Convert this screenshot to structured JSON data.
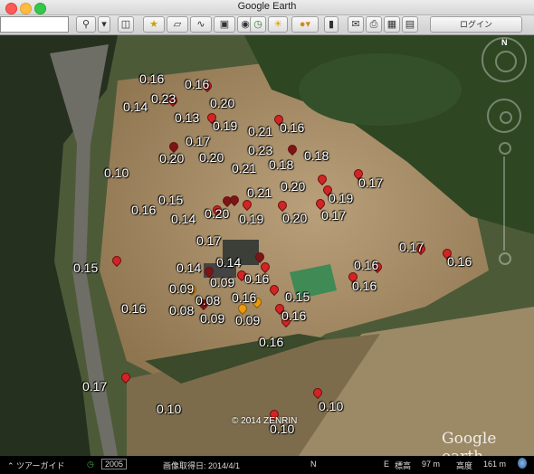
{
  "window": {
    "title": "Google Earth"
  },
  "toolbar": {
    "login_label": "ログイン"
  },
  "map": {
    "watermark": "Google earth",
    "copyright": "© 2014 ZENRIN",
    "compass_north": "N",
    "labels": [
      {
        "t": "0.16"
      },
      {
        "t": "0.16"
      },
      {
        "t": "0.23"
      },
      {
        "t": "0.14"
      },
      {
        "t": "0.20"
      },
      {
        "t": "0.13"
      },
      {
        "t": "0.19"
      },
      {
        "t": "0.21"
      },
      {
        "t": "0.16"
      },
      {
        "t": "0.17"
      },
      {
        "t": "0.23"
      },
      {
        "t": "0.20"
      },
      {
        "t": "0.20"
      },
      {
        "t": "0.18"
      },
      {
        "t": "0.18"
      },
      {
        "t": "0.21"
      },
      {
        "t": "0.10"
      },
      {
        "t": "0.17"
      },
      {
        "t": "0.15"
      },
      {
        "t": "0.20"
      },
      {
        "t": "0.21"
      },
      {
        "t": "0.19"
      },
      {
        "t": "0.16"
      },
      {
        "t": "0.14"
      },
      {
        "t": "0.20"
      },
      {
        "t": "0.19"
      },
      {
        "t": "0.20"
      },
      {
        "t": "0.17"
      },
      {
        "t": "0.17"
      },
      {
        "t": "0.17"
      },
      {
        "t": "0.16"
      },
      {
        "t": "0.15"
      },
      {
        "t": "0.14"
      },
      {
        "t": "0.14"
      },
      {
        "t": "0.16"
      },
      {
        "t": "0.16"
      },
      {
        "t": "0.16"
      },
      {
        "t": "0.09"
      },
      {
        "t": "0.09"
      },
      {
        "t": "0.15"
      },
      {
        "t": "0.08"
      },
      {
        "t": "0.16"
      },
      {
        "t": "0.16"
      },
      {
        "t": "0.08"
      },
      {
        "t": "0.09"
      },
      {
        "t": "0.09"
      },
      {
        "t": "0.16"
      },
      {
        "t": "0.16"
      },
      {
        "t": "0.17"
      },
      {
        "t": "0.10"
      },
      {
        "t": "0.10"
      },
      {
        "t": "0.10"
      }
    ]
  },
  "status": {
    "tour_guide": "ツアーガイド",
    "year": "2005",
    "imagery_date": "画像取得日: 2014/4/1",
    "lat_suffix": "N",
    "lon_suffix": "E",
    "elev_label": "標高",
    "elev_value": "97 m",
    "alt_label": "高度",
    "alt_value": "161 m"
  }
}
